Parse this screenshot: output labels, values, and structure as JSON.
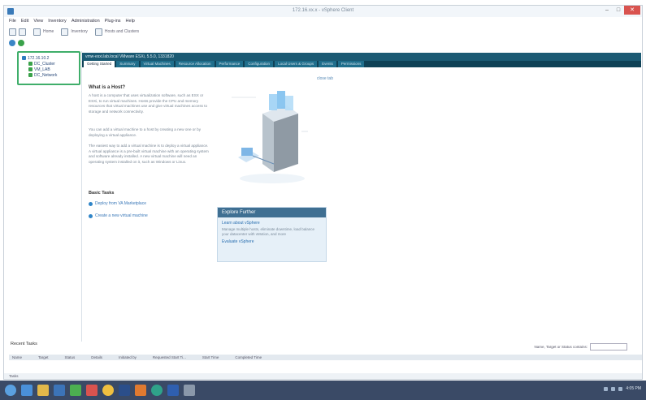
{
  "window": {
    "title": "172.16.xx.x - vSphere Client"
  },
  "menu": [
    "File",
    "Edit",
    "View",
    "Inventory",
    "Administration",
    "Plug-ins",
    "Help"
  ],
  "toolbar": {
    "home_label": "Home",
    "inventory_label": "Inventory",
    "hosts_label": "Hosts and Clusters"
  },
  "tree": {
    "root": "172.16.10.2",
    "items": [
      "DC_Cluster",
      "VM_LAB",
      "DC_Network"
    ]
  },
  "content": {
    "header": "vmw-esxi.lab.local VMware ESXi, 5.5.0, 1331820",
    "tabs": [
      "Getting Started",
      "Summary",
      "Virtual Machines",
      "Resource Allocation",
      "Performance",
      "Configuration",
      "Local Users & Groups",
      "Events",
      "Permissions"
    ],
    "close_tab": "close tab",
    "what_title": "What is a Host?",
    "p1": "A host is a computer that uses virtualization software, such as ESX or ESXi, to run virtual machines. Hosts provide the CPU and memory resources that virtual machines use and give virtual machines access to storage and network connectivity.",
    "p2": "You can add a virtual machine to a host by creating a new one or by deploying a virtual appliance.",
    "p3": "The easiest way to add a virtual machine is to deploy a virtual appliance. A virtual appliance is a pre-built virtual machine with an operating system and software already installed. A new virtual machine will need an operating system installed on it, such as Windows or Linux.",
    "basic_title": "Basic Tasks",
    "tasks": [
      "Deploy from VA Marketplace",
      "Create a new virtual machine"
    ]
  },
  "explore": {
    "title": "Explore Further",
    "link1": "Learn about vSphere",
    "desc": "Manage multiple hosts, eliminate downtime, load balance your datacenter with vMotion, and more",
    "link2": "Evaluate vSphere"
  },
  "recent": {
    "label": "Recent Tasks",
    "filter_label": "Name, Target or Status contains:",
    "columns": [
      "Name",
      "Target",
      "Status",
      "Details",
      "Initiated by",
      "Requested Start Ti...",
      "Start Time",
      "Completed Time"
    ]
  },
  "status": {
    "tasks_label": "Tasks"
  },
  "tray": {
    "time": "4:05 PM"
  }
}
